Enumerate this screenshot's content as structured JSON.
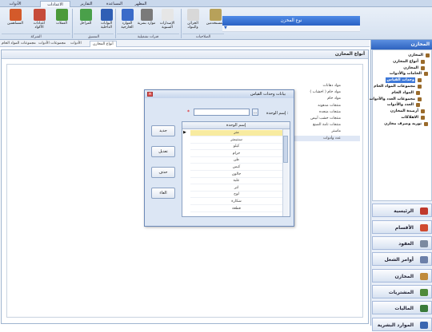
{
  "ribbon": {
    "tabs": [
      "الأدوات",
      "الاعدادات",
      "التقارير",
      "المساعدة",
      "المظهر"
    ],
    "active_tab": "الاعدادات",
    "buttons": [
      {
        "label": "المستخدمين",
        "color": "#b7a15a",
        "icon": "users-icon"
      },
      {
        "label": "الخزائن والبنوك",
        "color": "#d8d8d8",
        "icon": "safe-icon"
      },
      {
        "label": "الإصدارات السنوية",
        "color": "#e6e6e6",
        "icon": "calendar-icon"
      },
      {
        "label": "موارد بشرية",
        "color": "#7a7a7a",
        "icon": "hr-icon"
      },
      {
        "label": "الموارد الخارجية",
        "color": "#3a6bc9",
        "icon": "globe-icon"
      },
      {
        "label": "البوابات الداخلية",
        "color": "#2f5fb5",
        "icon": "gateway-icon"
      },
      {
        "label": "المراحل",
        "color": "#4aa04a",
        "icon": "stages-icon"
      },
      {
        "label": "العملات",
        "color": "#4c9a3a",
        "icon": "currency-icon"
      },
      {
        "label": "اعدادات الأكواد",
        "color": "#c64b3a",
        "icon": "codes-settings-icon"
      },
      {
        "label": "المساهمين",
        "color": "#d45a2a",
        "icon": "shareholders-icon"
      },
      {
        "label": "الشركة",
        "color": "#9aa9bd",
        "icon": "company-icon"
      }
    ],
    "groups": [
      "الصلاحيات",
      "فترات تشغيلية",
      "التنسيق",
      "الشركة"
    ]
  },
  "doc_tabs": [
    "أنواع المخازن",
    "الأدوات",
    "مجموعات الأدوات",
    "مجموعات المواد الخام"
  ],
  "main": {
    "title": "أنواع المخازن",
    "tree_header": "نوع المخزن",
    "tree_rows": [
      "مواد دهانات",
      "مواد خام ( اخشاب )",
      "مواد خام",
      "منتجات مدهونه",
      "منتجات منجده",
      "منتجات خشب أبيض",
      "منتجات تامة الصنع",
      "ماستر",
      "عدد وأدوات"
    ],
    "selected_row": "عدد وأدوات"
  },
  "sidebar": {
    "title": "المخازن",
    "tree": [
      {
        "label": "المخازن",
        "sel": false
      },
      {
        "label": "أنواع المخازن",
        "sel": false
      },
      {
        "label": "المخازن",
        "sel": false
      },
      {
        "label": "الخامات والأدوات",
        "sel": false
      },
      {
        "label": "وحدات القياس",
        "sel": true
      },
      {
        "label": "مجموعات المواد الخام",
        "sel": false
      },
      {
        "label": "المواد الخام",
        "sel": false
      },
      {
        "label": "مجموعات العدد والأدوات",
        "sel": false
      },
      {
        "label": "العدد والأدوات",
        "sel": false
      },
      {
        "label": "أرصدة المخازن",
        "sel": false
      },
      {
        "label": "الاهلاكات",
        "sel": false
      },
      {
        "label": "توريد وصرف مخازن",
        "sel": false
      }
    ],
    "modules": [
      {
        "label": "الرئيسية",
        "color": "#c0392b"
      },
      {
        "label": "الأقسام",
        "color": "#d04a2f"
      },
      {
        "label": "العقود",
        "color": "#7b8aa0"
      },
      {
        "label": "أوامر الشغل",
        "color": "#6b7fa8"
      },
      {
        "label": "المخازن",
        "color": "#c08a3a"
      },
      {
        "label": "المشتريات",
        "color": "#4f8a3a"
      },
      {
        "label": "الماليات",
        "color": "#3a7a3a"
      },
      {
        "label": "الموارد البشرية",
        "color": "#3a66b0"
      }
    ]
  },
  "dialog": {
    "title": "بيانات وحدات القياس",
    "unit_label": "إسم الوحدة :",
    "unit_value": "",
    "browse_label": "...",
    "required_mark": "*",
    "grid_header": "إسم الوحدة",
    "grid_rows": [
      "متر",
      "سنتيمتر",
      "كيلو",
      "جرام",
      "طن",
      "كيس",
      "جالون",
      "علبة",
      "لتر",
      "لوح",
      "شكارة",
      "قطعة"
    ],
    "selected_grid_row": "متر",
    "buttons": [
      "جديد",
      "تعديل",
      "حذف",
      "الغاء"
    ]
  }
}
